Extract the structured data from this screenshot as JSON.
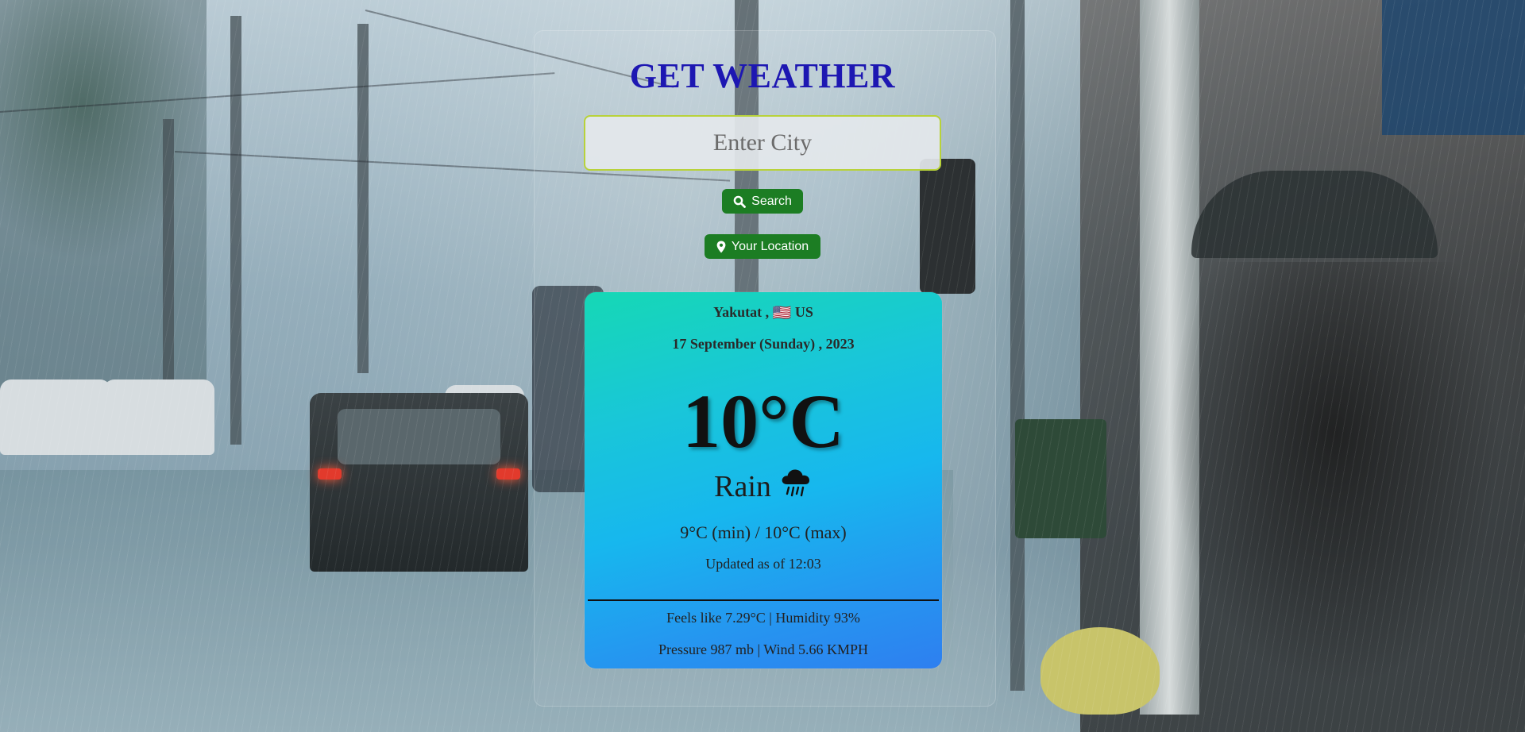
{
  "app": {
    "title": "GET WEATHER"
  },
  "search": {
    "placeholder": "Enter City",
    "value": "",
    "search_button_label": "Search",
    "location_button_label": "Your Location"
  },
  "weather": {
    "city": "Yakutat",
    "country_code": "US",
    "flag": "🇺🇸",
    "date": "17 September (Sunday) , 2023",
    "temperature": "10°C",
    "condition": "Rain",
    "min_max": "9°C (min) / 10°C (max)",
    "updated": "Updated as of 12:03",
    "feels_humidity": "Feels like 7.29°C | Humidity 93%",
    "pressure_wind": "Pressure 987 mb | Wind 5.66 KMPH"
  },
  "icons": {
    "search": "search-icon",
    "location": "map-pin-icon",
    "condition": "rain-cloud-icon"
  },
  "colors": {
    "title": "#1d17b2",
    "button": "#1c7d23",
    "input_border": "#b8d23a",
    "card_gradient_start": "#16d8b5",
    "card_gradient_end": "#2e7ff0"
  }
}
